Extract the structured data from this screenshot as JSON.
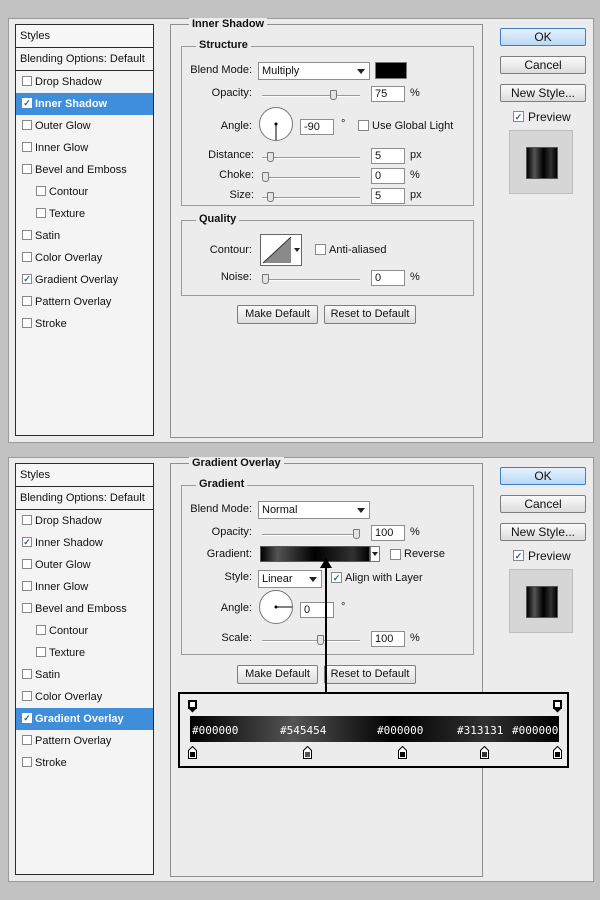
{
  "styles_list": {
    "header": "Styles",
    "blending": "Blending Options: Default",
    "items": [
      {
        "label": "Drop Shadow",
        "checked": false
      },
      {
        "label": "Inner Shadow",
        "checked": true
      },
      {
        "label": "Outer Glow",
        "checked": false
      },
      {
        "label": "Inner Glow",
        "checked": false
      },
      {
        "label": "Bevel and Emboss",
        "checked": false
      },
      {
        "label": "Contour",
        "checked": false
      },
      {
        "label": "Texture",
        "checked": false
      },
      {
        "label": "Satin",
        "checked": false
      },
      {
        "label": "Color Overlay",
        "checked": false
      },
      {
        "label": "Gradient Overlay",
        "checked": true
      },
      {
        "label": "Pattern Overlay",
        "checked": false
      },
      {
        "label": "Stroke",
        "checked": false
      }
    ]
  },
  "right_buttons": {
    "ok": "OK",
    "cancel": "Cancel",
    "new_style": "New Style...",
    "preview": "Preview"
  },
  "inner_shadow": {
    "title": "Inner Shadow",
    "structure_title": "Structure",
    "blend_mode_label": "Blend Mode:",
    "blend_mode": "Multiply",
    "color": "#000000",
    "opacity_label": "Opacity:",
    "opacity": "75",
    "angle_label": "Angle:",
    "angle": "-90",
    "degree": "°",
    "global_light": "Use Global Light",
    "distance_label": "Distance:",
    "distance": "5",
    "choke_label": "Choke:",
    "choke": "0",
    "size_label": "Size:",
    "size": "5",
    "px": "px",
    "pct": "%",
    "quality_title": "Quality",
    "contour_label": "Contour:",
    "anti_aliased": "Anti-aliased",
    "noise_label": "Noise:",
    "noise": "0",
    "make_default": "Make Default",
    "reset_default": "Reset to Default",
    "slider_fraction": {
      "opacity": 0.75,
      "distance": 0.05,
      "choke": 0,
      "size": 0.05,
      "noise": 0
    }
  },
  "gradient_overlay": {
    "title": "Gradient Overlay",
    "gradient_title": "Gradient",
    "blend_mode_label": "Blend Mode:",
    "blend_mode": "Normal",
    "opacity_label": "Opacity:",
    "opacity": "100",
    "gradient_label": "Gradient:",
    "reverse": "Reverse",
    "style_label": "Style:",
    "style": "Linear",
    "align_layer": "Align with Layer",
    "angle_label": "Angle:",
    "angle": "0",
    "degree": "°",
    "scale_label": "Scale:",
    "scale": "100",
    "pct": "%",
    "make_default": "Make Default",
    "reset_default": "Reset to Default",
    "slider_fraction": {
      "opacity": 1.0,
      "scale": 0.6
    }
  },
  "gradient_editor": {
    "stops": [
      {
        "label": "#000000",
        "color": "#000000"
      },
      {
        "label": "#545454",
        "color": "#545454"
      },
      {
        "label": "#000000",
        "color": "#000000"
      },
      {
        "label": "#313131",
        "color": "#313131"
      },
      {
        "label": "#000000",
        "color": "#000000"
      }
    ]
  }
}
